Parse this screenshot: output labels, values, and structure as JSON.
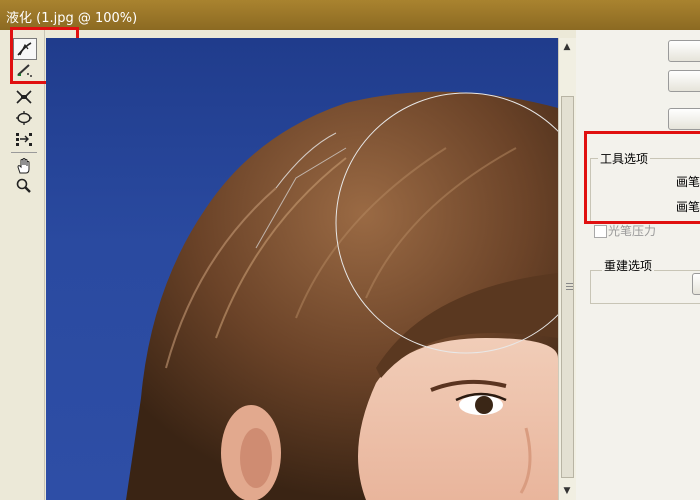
{
  "window": {
    "title": "液化 (1.jpg @ 100%)"
  },
  "tools": [
    {
      "name": "forward-warp-icon",
      "active": true
    },
    {
      "name": "reconstruct-icon"
    },
    {
      "name": "pucker-icon"
    },
    {
      "name": "bloat-icon"
    },
    {
      "name": "push-left-icon"
    },
    {
      "name": "hand-icon"
    },
    {
      "name": "zoom-icon"
    }
  ],
  "options": {
    "tool_options": {
      "title": "工具选项",
      "brush_size_label": "画笔",
      "brush_density_label": "画笔",
      "stylus_pressure_label": "光笔压力"
    },
    "reconstruct_options": {
      "title": "重建选项"
    }
  },
  "colors": {
    "highlight": "#e01010",
    "titlebar": "#9a7627",
    "background": "#2a4aa0"
  }
}
